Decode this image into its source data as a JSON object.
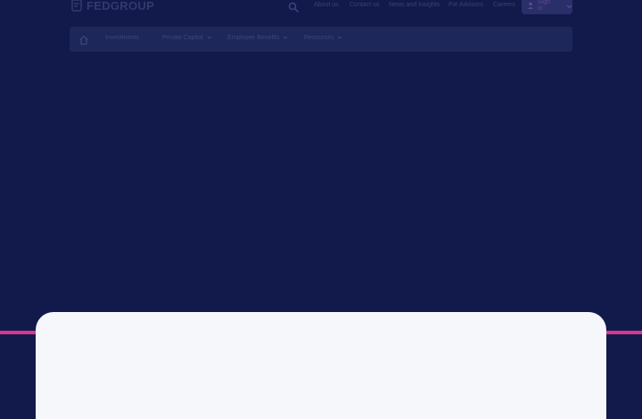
{
  "brand": {
    "name": "FEDGROUP",
    "logo_icon": "fedgroup-logo-icon"
  },
  "header": {
    "search_icon": "search-icon",
    "links": [
      "About us",
      "Contact us",
      "News and Insights",
      "For Advisors",
      "Careers"
    ],
    "signin": {
      "label": "Sign in",
      "icon": "user-icon",
      "chevron": "chevron-down-icon"
    }
  },
  "nav": {
    "home_icon": "home-icon",
    "items": [
      {
        "label": "Investments",
        "has_dropdown": false
      },
      {
        "label": "Private Capital",
        "has_dropdown": true
      },
      {
        "label": "Employee Benefits",
        "has_dropdown": true
      },
      {
        "label": "Resources",
        "has_dropdown": true
      }
    ]
  },
  "colors": {
    "background": "#121a4b",
    "navbar": "#1e2759",
    "accent_line": "#d6378f",
    "card": "#f5f7fb"
  }
}
